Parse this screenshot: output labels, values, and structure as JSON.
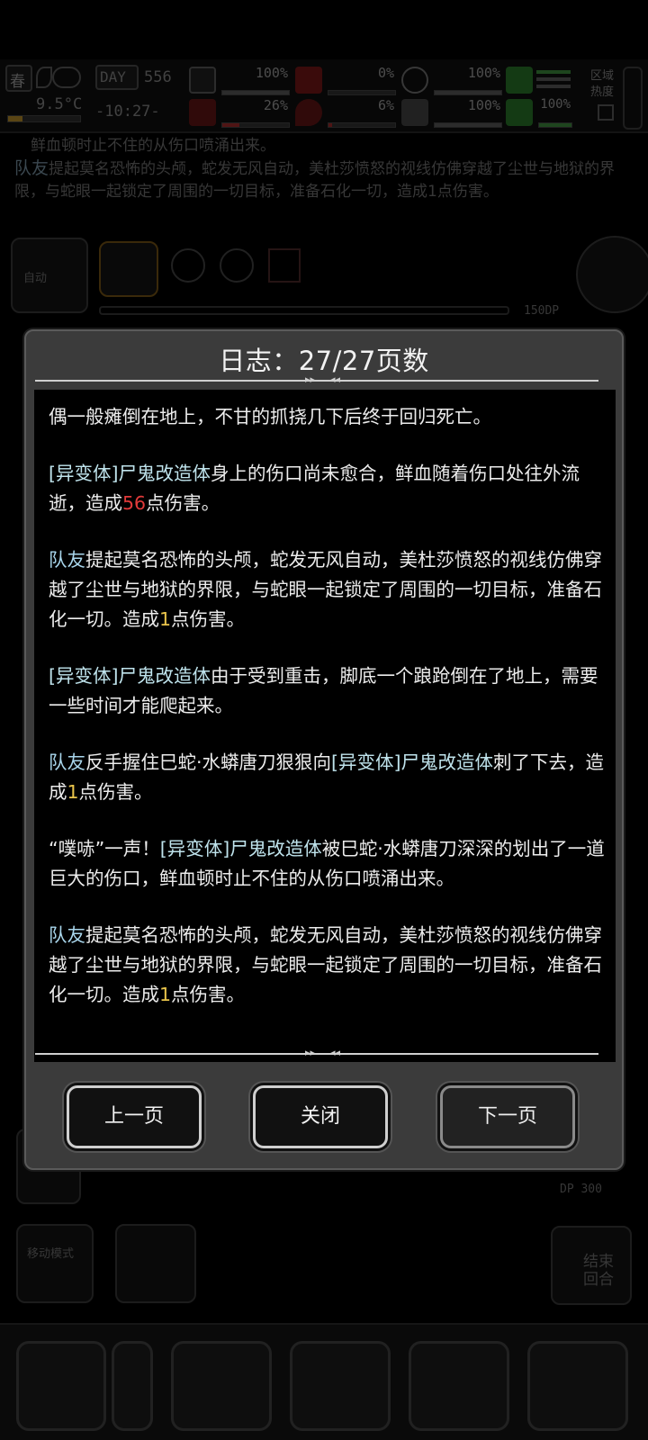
{
  "topbar": {
    "season": "春",
    "temperature": "9.5°C",
    "day_label": "DAY",
    "day_number": "556",
    "time": "-10:27-",
    "region_heat_label": "区域热度",
    "stats": [
      {
        "icon": "medkit-icon",
        "value": "100%",
        "fill": 1.0,
        "color": "#3a8a3a"
      },
      {
        "icon": "stomach-icon",
        "value": "0%",
        "fill": 0.0,
        "color": "#a33"
      },
      {
        "icon": "mood-icon",
        "value": "100%",
        "fill": 1.0,
        "color": "#3a8a3a"
      },
      {
        "icon": "boot-icon",
        "value": "",
        "fill": 1.0,
        "color": "#3a8a3a"
      },
      {
        "icon": "health-icon",
        "value": "26%",
        "fill": 0.26,
        "color": "#a33"
      },
      {
        "icon": "blood-icon",
        "value": "6%",
        "fill": 0.06,
        "color": "#a33"
      },
      {
        "icon": "heart-icon",
        "value": "100%",
        "fill": 1.0,
        "color": "#3a8a3a"
      },
      {
        "icon": "stamina-icon",
        "value": "100%",
        "fill": 1.0,
        "color": "#3a8a3a"
      }
    ]
  },
  "background_log": [
    {
      "who": "",
      "text": "鲜血顿时止不住的从伤口喷涌出来。"
    },
    {
      "who": "队友",
      "text": "提起莫名恐怖的头颅，蛇发无风自动，美杜莎愤怒的视线仿佛穿越了尘世与地狱的界限，与蛇眼一起锁定了周围的一切目标，准备石化一切，造成1点伤害。"
    }
  ],
  "battle": {
    "auto_label": "自动",
    "dp_text": "150DP",
    "dp_text_2": "DP 300",
    "move_mode_label": "移动模式",
    "end_turn_label": "结束回合"
  },
  "dialog": {
    "title": "日志：27/27页数",
    "buttons": {
      "prev": "上一页",
      "close": "关闭",
      "next": "下一页"
    },
    "entries": [
      [
        {
          "t": "偶一般瘫倒在地上，不甘的抓挠几下后终于回归死亡。",
          "c": ""
        }
      ],
      [
        {
          "t": "[异变体]尸鬼改造体",
          "c": "tag"
        },
        {
          "t": "身上的伤口尚未愈合，鲜血随着伤口处往外流逝，造成",
          "c": ""
        },
        {
          "t": "56",
          "c": "red"
        },
        {
          "t": "点伤害。",
          "c": ""
        }
      ],
      [
        {
          "t": "队友",
          "c": "team"
        },
        {
          "t": "提起莫名恐怖的头颅，蛇发无风自动，美杜莎愤怒的视线仿佛穿越了尘世与地狱的界限，与蛇眼一起锁定了周围的一切目标，准备石化一切。造成",
          "c": ""
        },
        {
          "t": "1",
          "c": "gold"
        },
        {
          "t": "点伤害。",
          "c": ""
        }
      ],
      [
        {
          "t": "[异变体]尸鬼改造体",
          "c": "tag"
        },
        {
          "t": "由于受到重击，脚底一个踉跄倒在了地上，需要一些时间才能爬起来。",
          "c": ""
        }
      ],
      [
        {
          "t": "队友",
          "c": "team"
        },
        {
          "t": "反手握住巳蛇·水蟒唐刀狠狠向",
          "c": ""
        },
        {
          "t": "[异变体]尸鬼改造体",
          "c": "tag"
        },
        {
          "t": "刺了下去，造成",
          "c": ""
        },
        {
          "t": "1",
          "c": "gold"
        },
        {
          "t": "点伤害。",
          "c": ""
        }
      ],
      [
        {
          "t": "“噗哧”一声！",
          "c": ""
        },
        {
          "t": "[异变体]尸鬼改造体",
          "c": "tag"
        },
        {
          "t": "被巳蛇·水蟒唐刀深深的划出了一道巨大的伤口，鲜血顿时止不住的从伤口喷涌出来。",
          "c": ""
        }
      ],
      [
        {
          "t": "队友",
          "c": "team"
        },
        {
          "t": "提起莫名恐怖的头颅，蛇发无风自动，美杜莎愤怒的视线仿佛穿越了尘世与地狱的界限，与蛇眼一起锁定了周围的一切目标，准备石化一切。造成",
          "c": ""
        },
        {
          "t": "1",
          "c": "gold"
        },
        {
          "t": "点伤害。",
          "c": ""
        }
      ]
    ]
  }
}
